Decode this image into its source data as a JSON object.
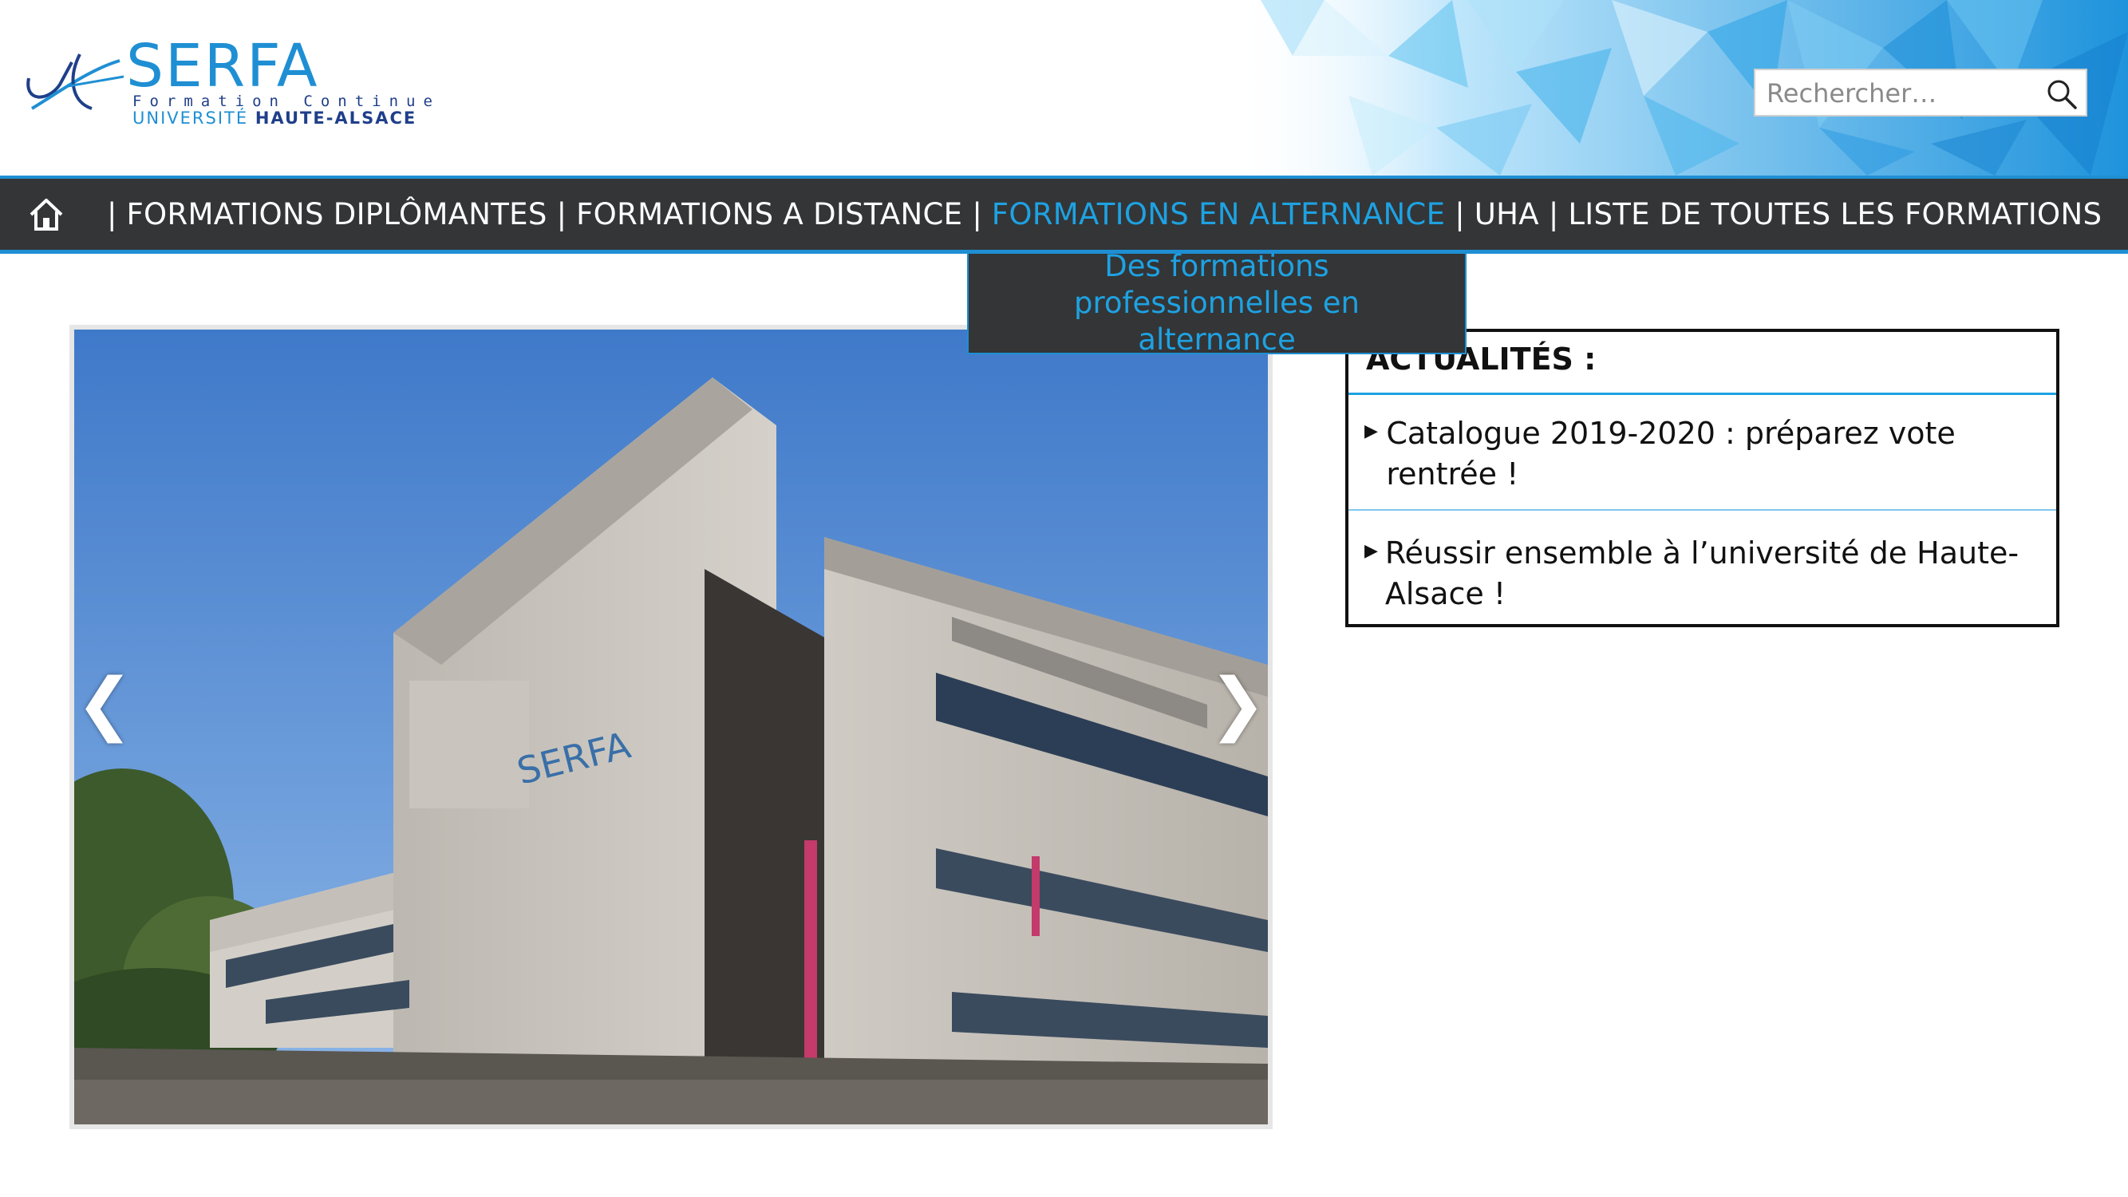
{
  "logo": {
    "title": "SERFA",
    "subtitle": "Formation Continue",
    "university_part1": "UNIVERSITÉ",
    "university_part2": "HAUTE-ALSACE"
  },
  "search": {
    "placeholder": "Rechercher…",
    "value": ""
  },
  "nav": {
    "separator": "|",
    "items": [
      {
        "label": "FORMATIONS DIPLÔMANTES"
      },
      {
        "label": "FORMATIONS A DISTANCE"
      },
      {
        "label": "FORMATIONS EN ALTERNANCE"
      },
      {
        "label": "UHA"
      },
      {
        "label": "LISTE DE TOUTES LES FORMATIONS"
      }
    ],
    "active_index": 2,
    "dropdown": {
      "item": "Des formations professionnelles en alternance"
    }
  },
  "slider": {
    "prev_symbol": "❮",
    "next_symbol": "❯",
    "sign_text": "SERFA"
  },
  "news": {
    "title": "ACTUALITÉS :",
    "items": [
      {
        "text": "Catalogue 2019-2020 : préparez vote rentrée !"
      },
      {
        "text": "Réussir ensemble à l’université de Haute-Alsace !"
      }
    ],
    "bullet": "▶"
  },
  "colors": {
    "brand_blue": "#1f8fd3",
    "accent_blue": "#1ea2e2",
    "nav_bg": "#333537"
  },
  "icons": {
    "home": "home-icon",
    "search": "search-icon",
    "logo_mark": "logo-mark-icon"
  }
}
